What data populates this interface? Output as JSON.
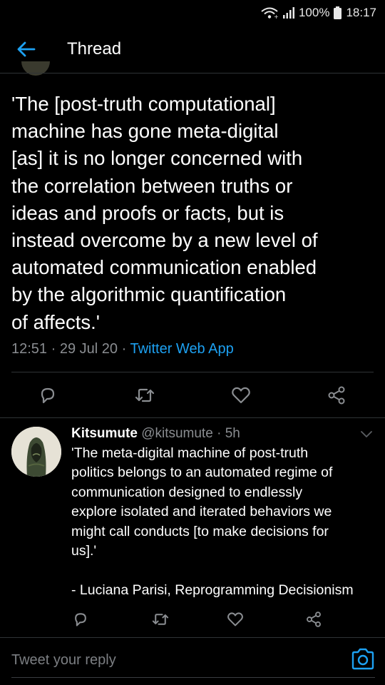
{
  "status_bar": {
    "battery": "100%",
    "time": "18:17",
    "icons": [
      "wifi-icon",
      "signal-icon",
      "battery-icon"
    ]
  },
  "app_bar": {
    "back_icon": "back-arrow-icon",
    "title": "Thread"
  },
  "main_tweet": {
    "text": "'The [post-truth computational]\nmachine has gone meta-digital\n[as] it is no longer concerned with\nthe correlation between truths or\nideas and proofs or facts, but is\ninstead overcome by a new level of\nautomated communication enabled\nby the algorithmic quantification\nof affects.'",
    "time": "12:51",
    "date": "29 Jul 20",
    "source": "Twitter Web App",
    "separator": "·",
    "actions": [
      "reply-icon",
      "retweet-icon",
      "like-icon",
      "share-icon"
    ]
  },
  "reply": {
    "name": "Kitsumute",
    "handle": "@kitsumute",
    "separator": "·",
    "age": "5h",
    "text": "'The meta-digital machine of post-truth\npolitics belongs to an automated regime of\ncommunication designed to endlessly\nexplore isolated and iterated behaviors we\nmight call conducts [to make decisions for\nus].'\n\n- Luciana Parisi, Reprogramming Decisionism",
    "actions": [
      "reply-icon",
      "retweet-icon",
      "like-icon",
      "share-icon"
    ]
  },
  "compose": {
    "placeholder": "Tweet your reply",
    "value": "",
    "camera_icon": "camera-icon"
  },
  "colors": {
    "background": "#000000",
    "accent": "#1da1f2",
    "muted": "#8a8d91",
    "divider": "#2f3336"
  }
}
